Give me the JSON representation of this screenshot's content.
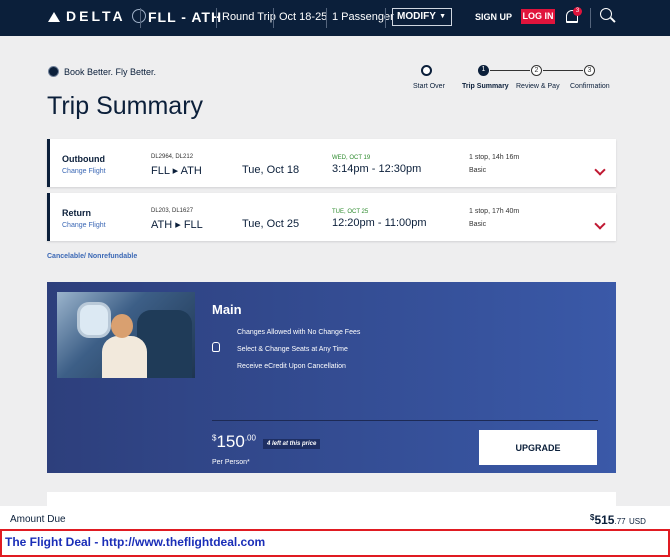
{
  "header": {
    "brand": "DELTA",
    "route": "FLL - ATH",
    "trip_type": "Round Trip",
    "dates": "Oct 18-25",
    "passengers": "1 Passenger",
    "modify_label": "MODIFY",
    "signup_label": "SIGN UP",
    "login_label": "LOG IN",
    "notification_count": "3"
  },
  "tagline": "Book Better. Fly Better.",
  "page_title": "Trip Summary",
  "steps": [
    {
      "label": "Start Over",
      "num": ""
    },
    {
      "label": "Trip Summary",
      "num": "1"
    },
    {
      "label": "Review & Pay",
      "num": "2"
    },
    {
      "label": "Confirmation",
      "num": "3"
    }
  ],
  "flights": [
    {
      "direction": "Outbound",
      "change_label": "Change Flight",
      "flight_numbers": "DL2964, DL212",
      "route": "FLL ▸ ATH",
      "date": "Tue, Oct 18",
      "depart_day": "WED, OCT 19",
      "times": "3:14pm - 12:30pm",
      "stops": "1 stop, 14h 16m",
      "fare": "Basic"
    },
    {
      "direction": "Return",
      "change_label": "Change Flight",
      "flight_numbers": "DL203, DL1627",
      "route": "ATH ▸ FLL",
      "date": "Tue, Oct 25",
      "depart_day": "TUE, OCT 25",
      "times": "12:20pm - 11:00pm",
      "stops": "1 stop, 17h 40m",
      "fare": "Basic"
    }
  ],
  "cancel_note": "Cancelable/ Nonrefundable",
  "upsell": {
    "title": "Main",
    "features": [
      "Changes Allowed with No Change Fees",
      "Select & Change Seats at Any Time",
      "Receive eCredit Upon Cancellation"
    ],
    "price_symbol": "$",
    "price_whole": "150",
    "price_cents": ".00",
    "seats_left": "4 left at this price",
    "per_person": "Per Person*",
    "upgrade_label": "UPGRADE"
  },
  "amount_due": {
    "label": "Amount Due",
    "symbol": "$",
    "whole": "515",
    "cents": ".77",
    "currency": "USD"
  },
  "footer_text": "The Flight Deal - http://www.theflightdeal.com"
}
